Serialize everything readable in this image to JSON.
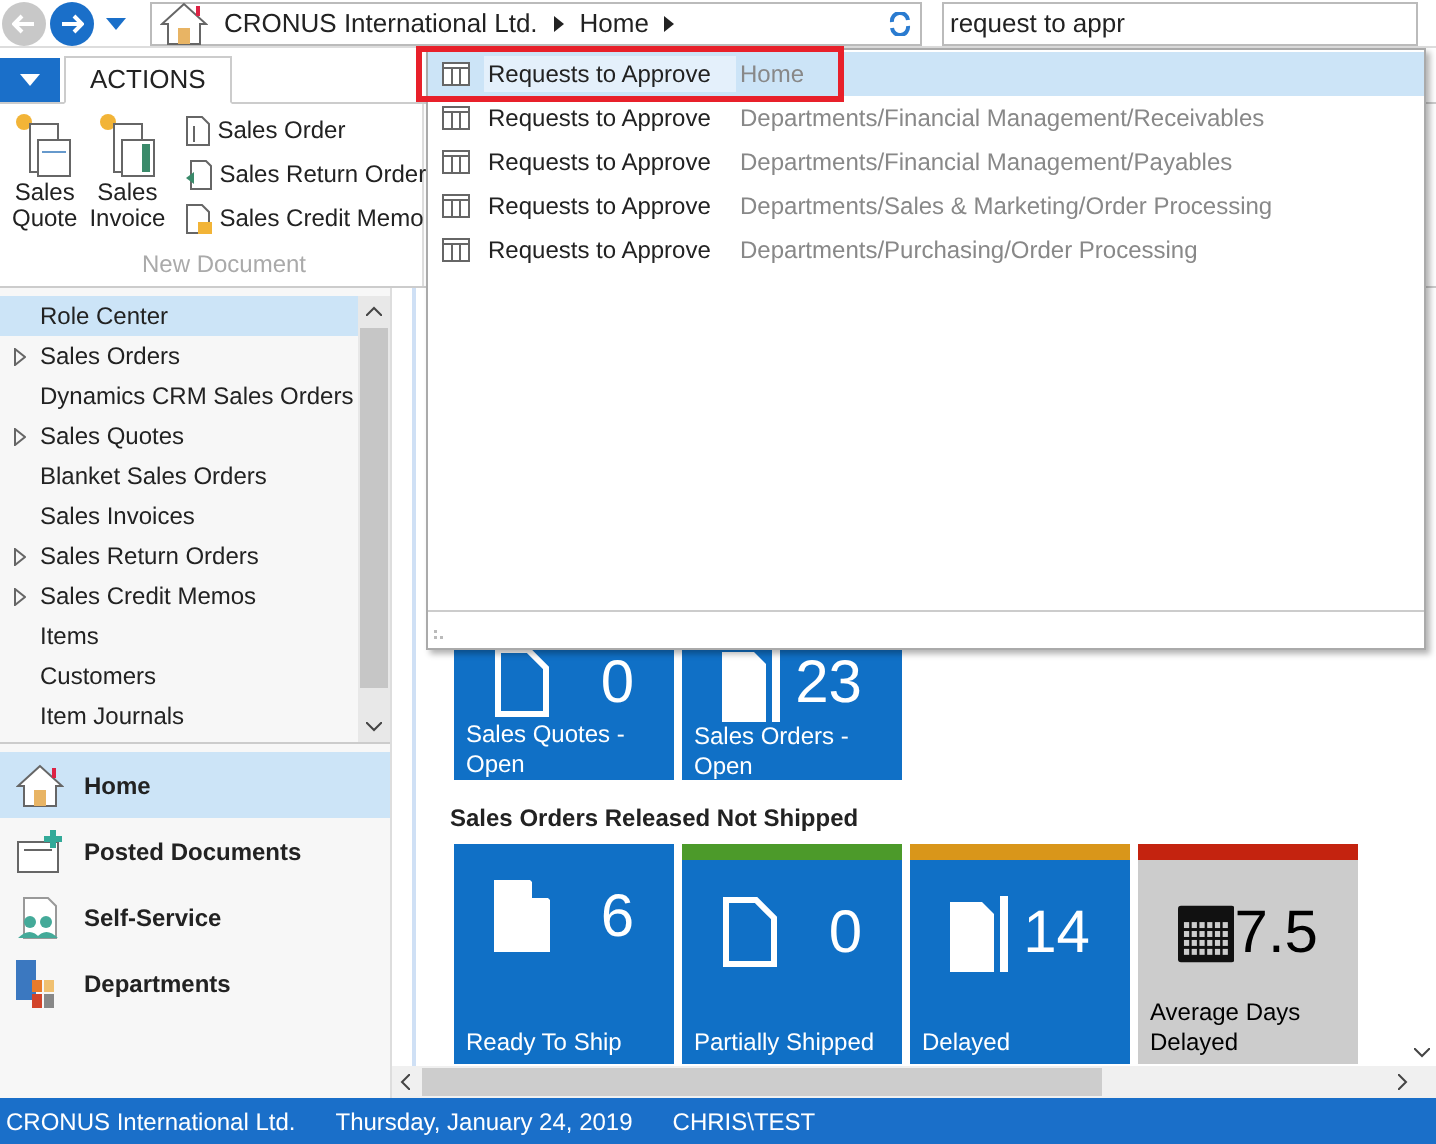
{
  "address_bar": {
    "crumbs": [
      "CRONUS International Ltd.",
      "Home"
    ]
  },
  "search": {
    "value": "request to appr"
  },
  "ribbon": {
    "tabs": [
      {
        "label": "ACTIONS",
        "selected": true
      }
    ],
    "large_buttons": [
      {
        "label": "Sales Quote",
        "kind": "quote"
      },
      {
        "label": "Sales Invoice",
        "kind": "invoice"
      }
    ],
    "small_buttons": [
      {
        "label": "Sales Order",
        "kind": "order"
      },
      {
        "label": "Sales Return Order",
        "kind": "return"
      },
      {
        "label": "Sales Credit Memo",
        "kind": "memo"
      }
    ],
    "group_label": "New Document"
  },
  "nav_list": [
    {
      "label": "Role Center",
      "expandable": false,
      "selected": true
    },
    {
      "label": "Sales Orders",
      "expandable": true,
      "selected": false
    },
    {
      "label": "Dynamics CRM Sales Orders",
      "expandable": false,
      "selected": false
    },
    {
      "label": "Sales Quotes",
      "expandable": true,
      "selected": false
    },
    {
      "label": "Blanket Sales Orders",
      "expandable": false,
      "selected": false
    },
    {
      "label": "Sales Invoices",
      "expandable": false,
      "selected": false
    },
    {
      "label": "Sales Return Orders",
      "expandable": true,
      "selected": false
    },
    {
      "label": "Sales Credit Memos",
      "expandable": true,
      "selected": false
    },
    {
      "label": "Items",
      "expandable": false,
      "selected": false
    },
    {
      "label": "Customers",
      "expandable": false,
      "selected": false
    },
    {
      "label": "Item Journals",
      "expandable": false,
      "selected": false
    }
  ],
  "nav_buttons": [
    {
      "label": "Home",
      "kind": "home",
      "selected": true
    },
    {
      "label": "Posted Documents",
      "kind": "posted",
      "selected": false
    },
    {
      "label": "Self-Service",
      "kind": "people",
      "selected": false
    },
    {
      "label": "Departments",
      "kind": "departments",
      "selected": false
    }
  ],
  "cue_groups": [
    {
      "tiles": [
        {
          "kind": "outline",
          "value": "0",
          "label": "Sales Quotes - Open"
        },
        {
          "kind": "stack",
          "value": "23",
          "label": "Sales Orders - Open"
        }
      ]
    },
    {
      "title": "Sales Orders Released Not Shipped",
      "tiles": [
        {
          "kind": "doc",
          "value": "6",
          "label": "Ready To Ship"
        },
        {
          "kind": "outline",
          "value": "0",
          "label": "Partially Shipped",
          "color": "#4c9a2a"
        },
        {
          "kind": "stack",
          "value": "14",
          "label": "Delayed",
          "color": "#d9961a"
        },
        {
          "kind": "calendar",
          "value": "7.5",
          "label": "Average Days Delayed",
          "color": "#c4230f"
        }
      ]
    }
  ],
  "search_results": [
    {
      "name": "Requests to Approve",
      "path": "Home",
      "selected": true
    },
    {
      "name": "Requests to Approve",
      "path": "Departments/Financial Management/Receivables",
      "selected": false
    },
    {
      "name": "Requests to Approve",
      "path": "Departments/Financial Management/Payables",
      "selected": false
    },
    {
      "name": "Requests to Approve",
      "path": "Departments/Sales & Marketing/Order Processing",
      "selected": false
    },
    {
      "name": "Requests to Approve",
      "path": "Departments/Purchasing/Order Processing",
      "selected": false
    }
  ],
  "status_bar": [
    "CRONUS International Ltd.",
    "Thursday, January 24, 2019",
    "CHRIS\\TEST"
  ]
}
